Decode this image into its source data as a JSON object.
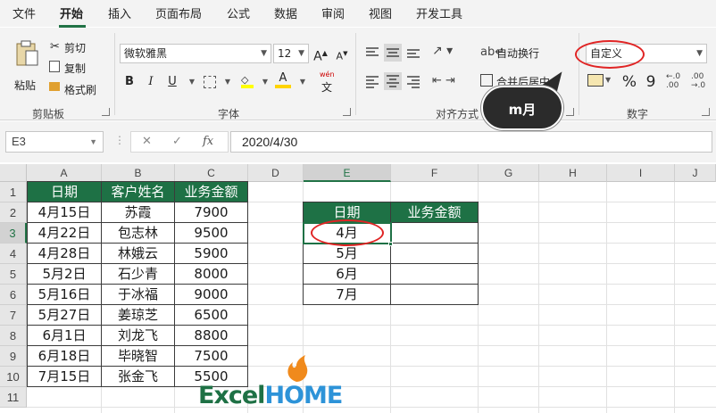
{
  "ribbon_tabs": [
    "文件",
    "开始",
    "插入",
    "页面布局",
    "公式",
    "数据",
    "审阅",
    "视图",
    "开发工具"
  ],
  "active_tab": "开始",
  "clipboard": {
    "paste": "粘贴",
    "cut": "剪切",
    "copy": "复制",
    "format_painter": "格式刷",
    "group": "剪贴板"
  },
  "font": {
    "name": "微软雅黑",
    "size": "12",
    "group": "字体",
    "bold": "B",
    "italic": "I",
    "underline": "U",
    "increase": "A",
    "decrease": "A",
    "font_color_letter": "A",
    "phonetic_top": "wén",
    "phonetic_bottom": "文"
  },
  "alignment": {
    "wrap_text": "自动换行",
    "merge": "合并后居中",
    "group": "对齐方式"
  },
  "number": {
    "format": "自定义",
    "group": "数字",
    "percent": "%",
    "comma": "9"
  },
  "callout": "m月",
  "formula_bar": {
    "name_box": "E3",
    "cancel": "✕",
    "enter": "✓",
    "fx": "fx",
    "formula": "2020/4/30"
  },
  "column_headers": [
    "A",
    "B",
    "C",
    "D",
    "E",
    "F",
    "G",
    "H",
    "I",
    "J"
  ],
  "row_headers": [
    "1",
    "2",
    "3",
    "4",
    "5",
    "6",
    "7",
    "8",
    "9",
    "10",
    "11"
  ],
  "source_table": {
    "headers": [
      "日期",
      "客户姓名",
      "业务金额"
    ],
    "rows": [
      [
        "4月15日",
        "苏霞",
        "7900"
      ],
      [
        "4月22日",
        "包志林",
        "9500"
      ],
      [
        "4月28日",
        "林娥云",
        "5900"
      ],
      [
        "5月2日",
        "石少青",
        "8000"
      ],
      [
        "5月16日",
        "于冰福",
        "9000"
      ],
      [
        "5月27日",
        "姜琼芝",
        "6500"
      ],
      [
        "6月1日",
        "刘龙飞",
        "8800"
      ],
      [
        "6月18日",
        "毕晓智",
        "7500"
      ],
      [
        "7月15日",
        "张金飞",
        "5500"
      ]
    ]
  },
  "summary_table": {
    "headers": [
      "日期",
      "业务金额"
    ],
    "rows": [
      [
        "4月",
        ""
      ],
      [
        "5月",
        ""
      ],
      [
        "6月",
        ""
      ],
      [
        "7月",
        ""
      ]
    ]
  },
  "logo": {
    "part1": "Excel",
    "part2": "HOME"
  },
  "colors": {
    "accent": "#1e7145",
    "highlight": "#e02424"
  }
}
